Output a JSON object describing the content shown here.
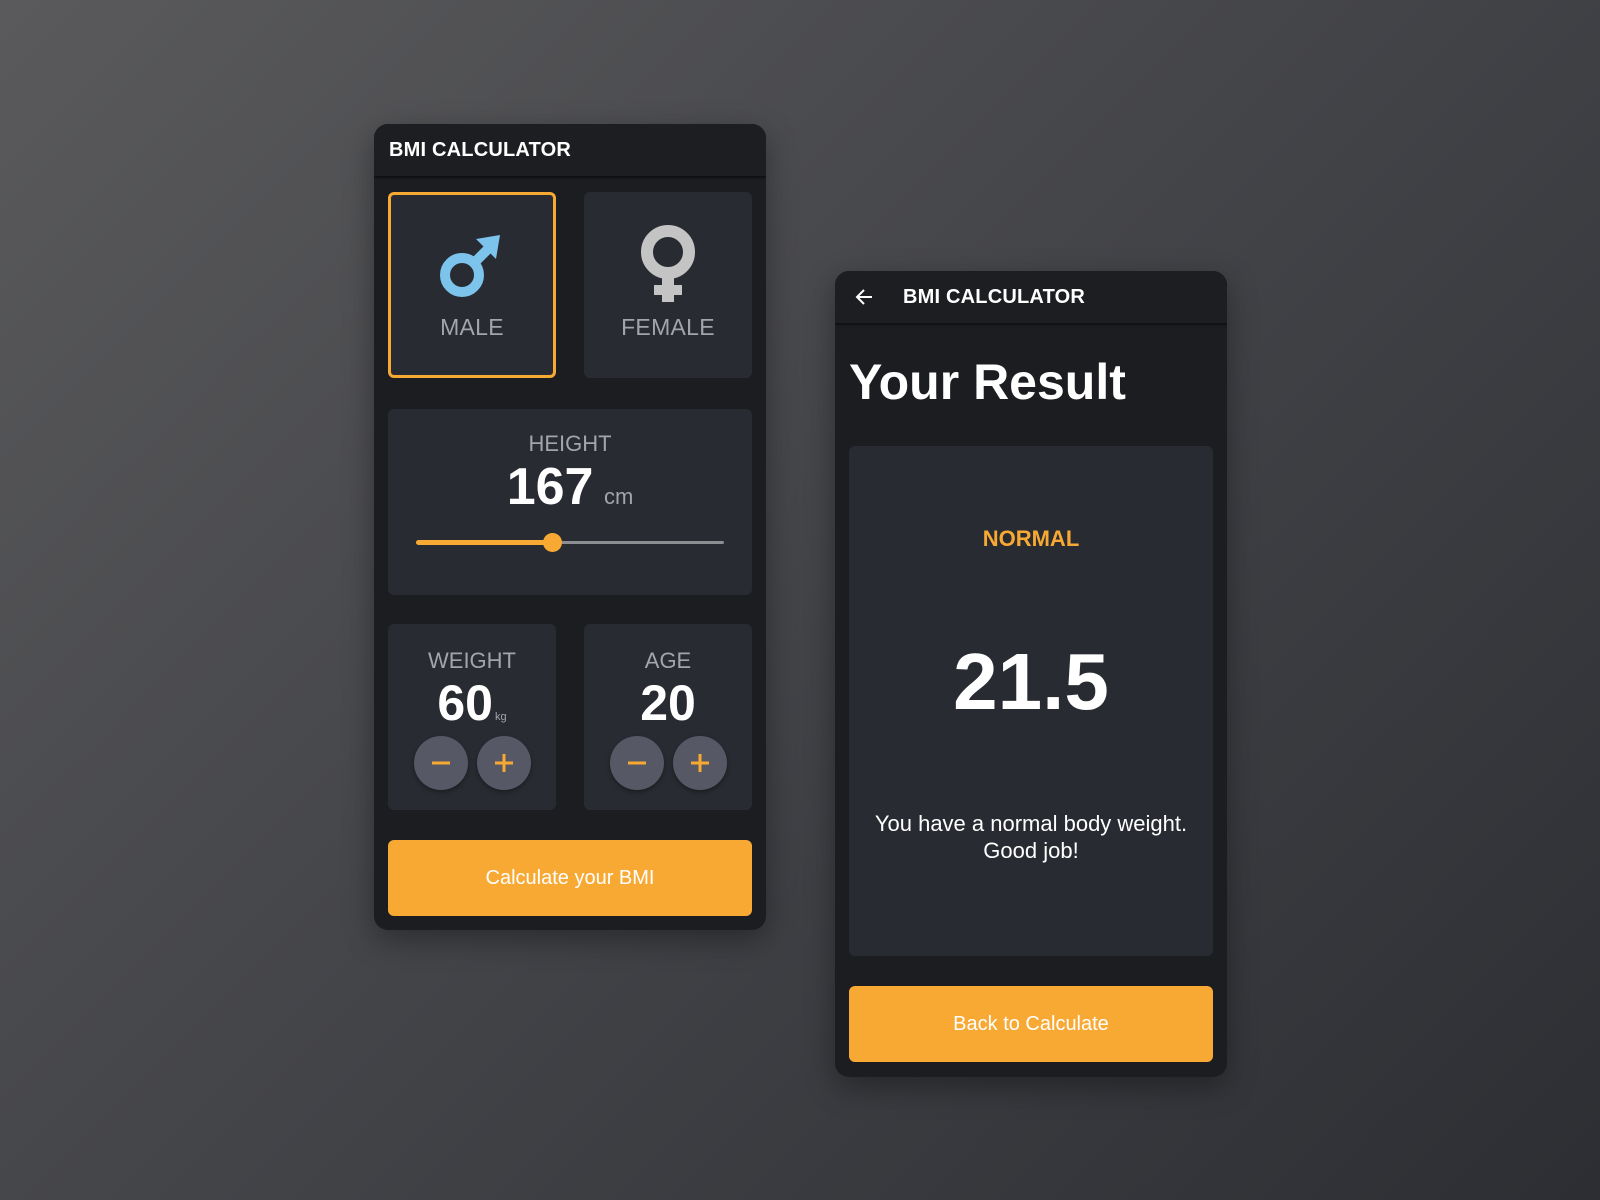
{
  "input_screen": {
    "appbar_title": "BMI CALCULATOR",
    "gender": {
      "male_label": "MALE",
      "female_label": "FEMALE",
      "selected": "male"
    },
    "height": {
      "label": "HEIGHT",
      "value": "167",
      "unit": "cm",
      "slider_fraction": 0.44
    },
    "weight": {
      "label": "WEIGHT",
      "value": "60",
      "unit": "kg",
      "minus_icon": "minus-icon",
      "plus_icon": "plus-icon"
    },
    "age": {
      "label": "AGE",
      "value": "20",
      "minus_icon": "minus-icon",
      "plus_icon": "plus-icon"
    },
    "calculate_label": "Calculate your BMI"
  },
  "result_screen": {
    "appbar_title": "BMI CALCULATOR",
    "back_icon": "arrow-left-icon",
    "heading": "Your Result",
    "status": "NORMAL",
    "bmi_value": "21.5",
    "message_line1": "You have a normal body weight.",
    "message_line2": "Good job!",
    "back_button_label": "Back to Calculate"
  },
  "colors": {
    "accent": "#f8a933",
    "male_icon": "#7cc4ec",
    "female_icon": "#c4c4c4",
    "card": "#282b31",
    "phone_bg": "#1b1d20",
    "stepper_button": "#565866"
  }
}
